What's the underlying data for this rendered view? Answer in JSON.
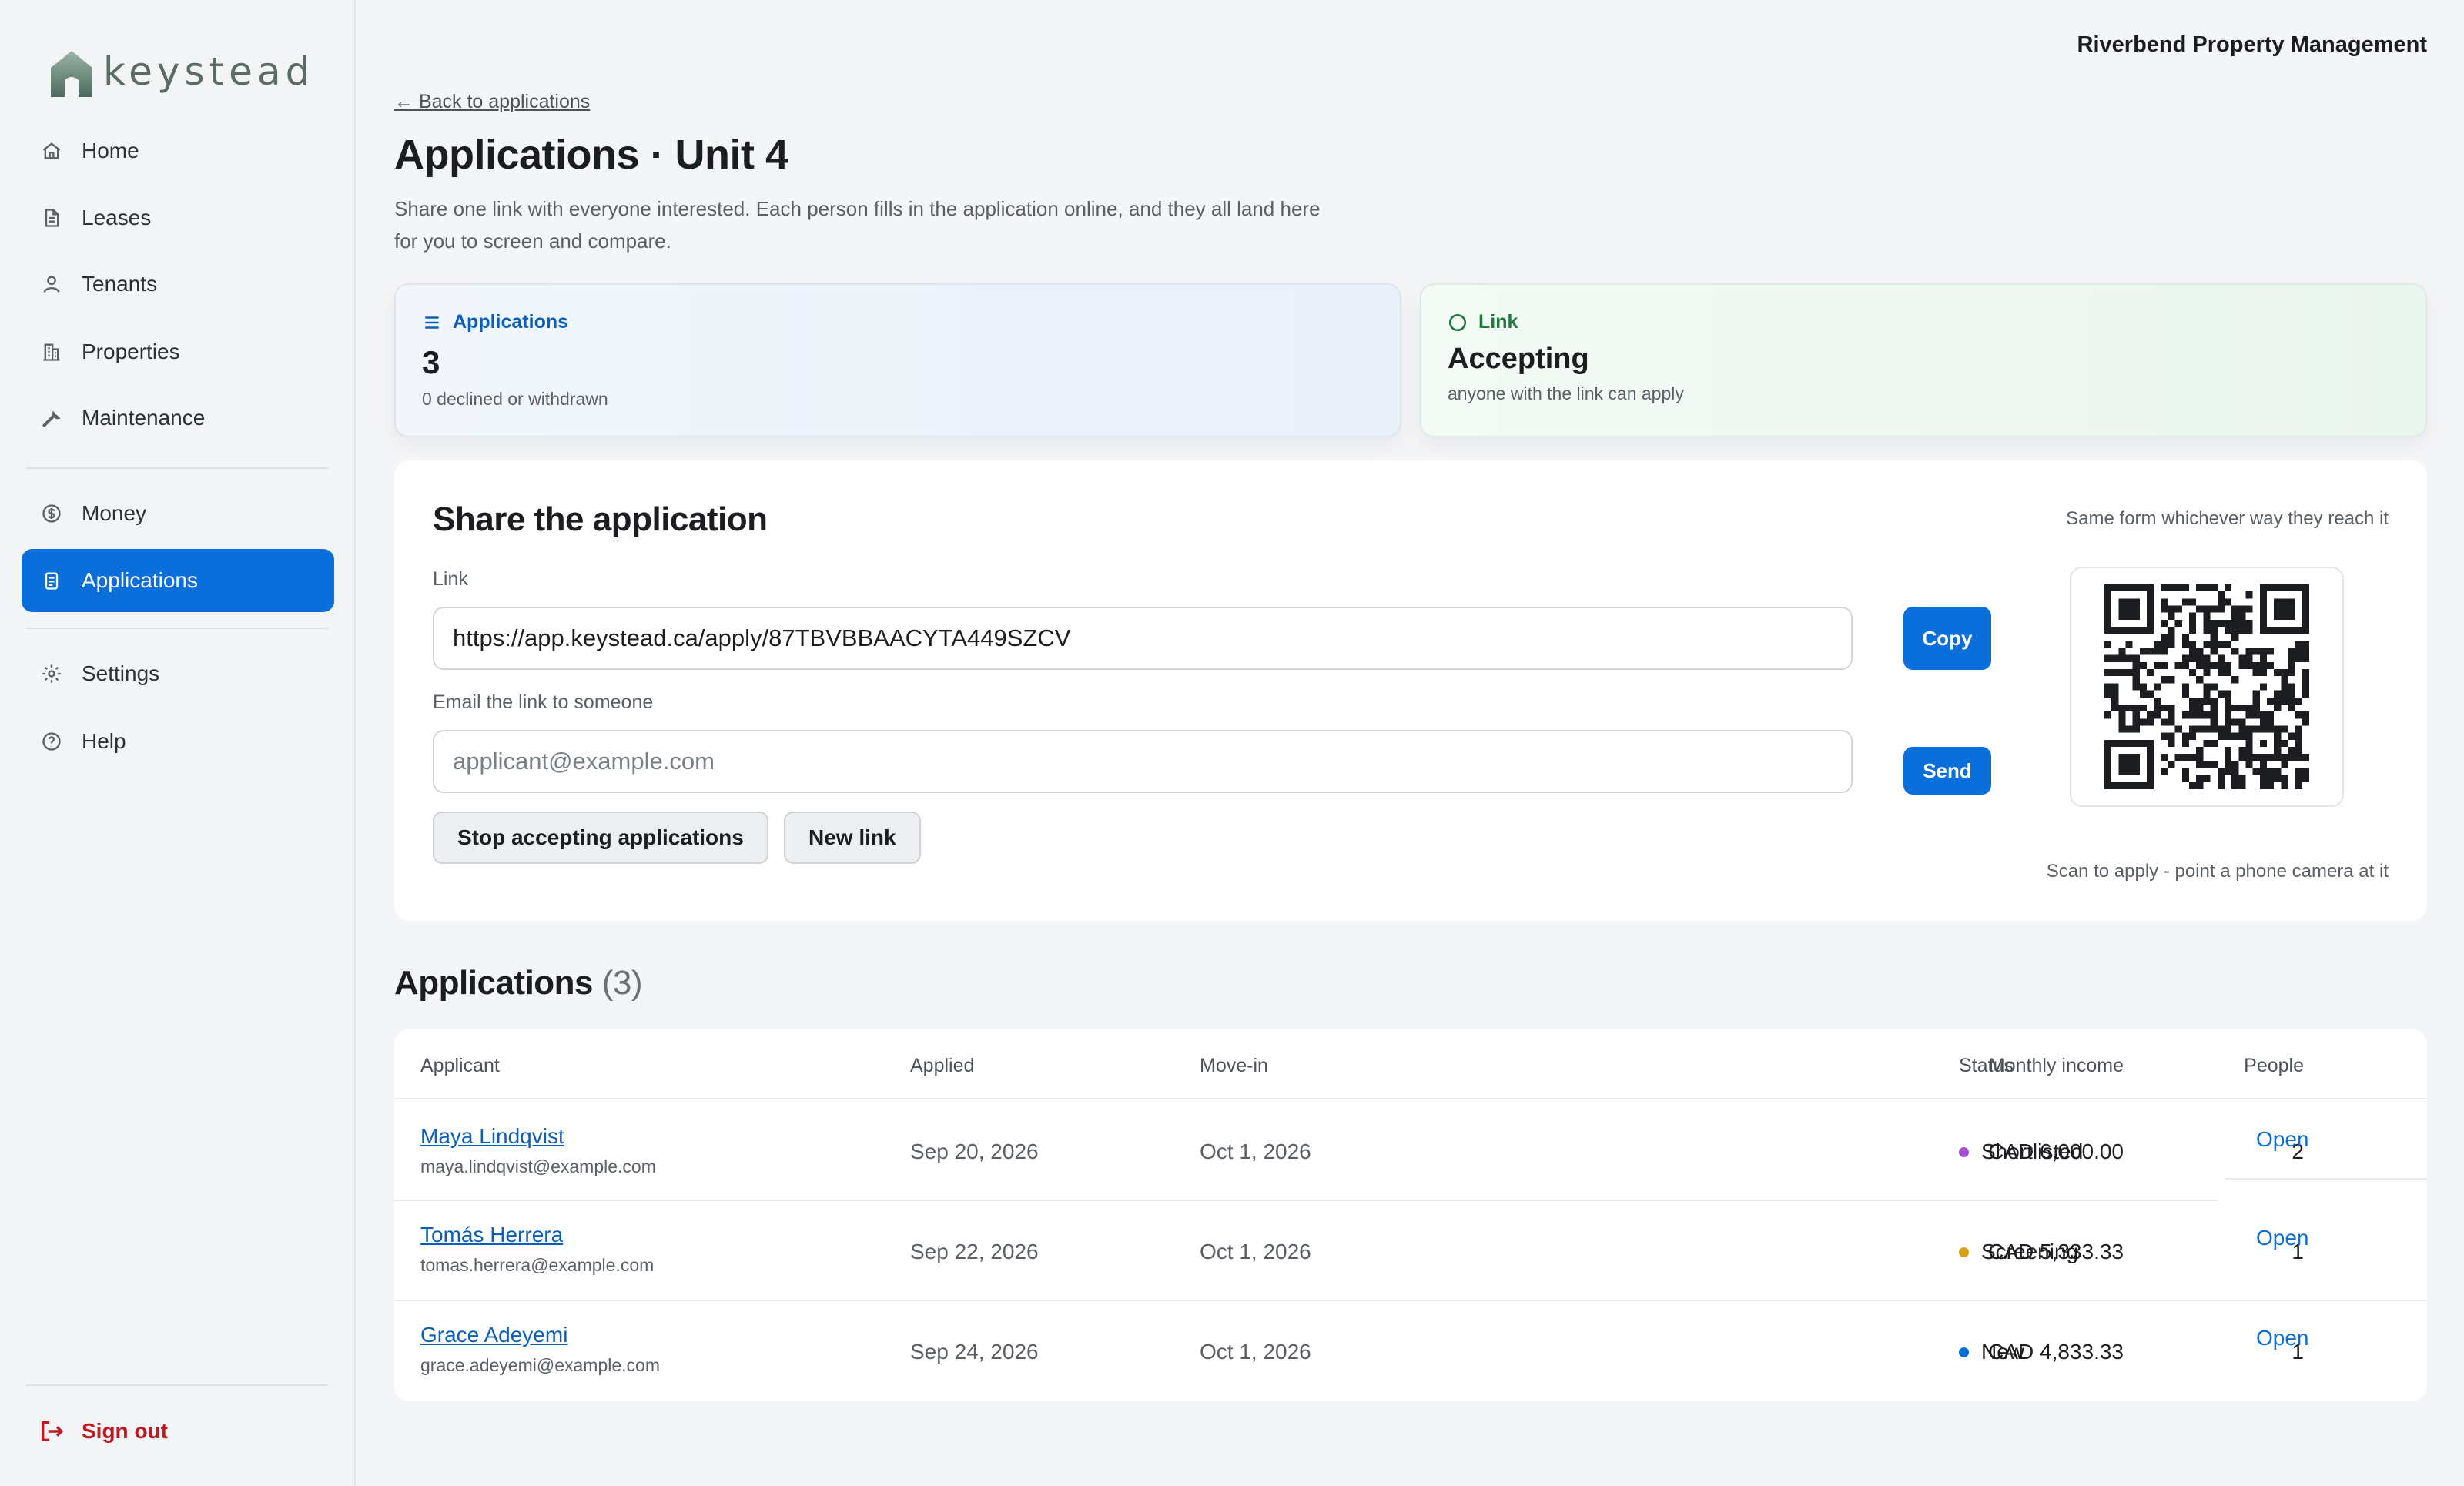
{
  "app": {
    "logo_text": "keystead",
    "org_name": "Riverbend Property Management"
  },
  "nav": {
    "items": [
      {
        "label": "Home",
        "icon": "home-icon"
      },
      {
        "label": "Leases",
        "icon": "document-icon"
      },
      {
        "label": "Tenants",
        "icon": "person-icon"
      },
      {
        "label": "Properties",
        "icon": "building-icon"
      },
      {
        "label": "Maintenance",
        "icon": "wrench-icon"
      },
      {
        "label": "Money",
        "icon": "dollar-circle-icon"
      },
      {
        "label": "Applications",
        "icon": "clipboard-icon",
        "active": true
      },
      {
        "label": "Settings",
        "icon": "gear-icon"
      },
      {
        "label": "Help",
        "icon": "help-circle-icon"
      }
    ],
    "sign_out": "Sign out"
  },
  "page": {
    "back_link": "← Back to applications",
    "title": "Applications · Unit 4",
    "subtitle": "Share one link with everyone interested. Each person fills in the application online, and they all land here for you to screen and compare."
  },
  "stats": {
    "applications": {
      "label": "Applications",
      "value": "3",
      "note": "0 declined or withdrawn"
    },
    "link": {
      "label": "Link",
      "value": "Accepting",
      "note": "anyone with the link can apply"
    }
  },
  "share": {
    "title": "Share the application",
    "right_note": "Same form whichever way they reach it",
    "link_label": "Link",
    "link_value": "https://app.keystead.ca/apply/87TBVBBAACYTA449SZCV",
    "copy_label": "Copy",
    "email_label": "Email the link to someone",
    "email_placeholder": "applicant@example.com",
    "send_label": "Send",
    "stop_label": "Stop accepting applications",
    "new_link_label": "New link",
    "qr_note": "Scan to apply - point a phone camera at it"
  },
  "list": {
    "title": "Applications",
    "count": "(3)",
    "columns": [
      "Applicant",
      "Applied",
      "Move-in",
      "Monthly income",
      "People",
      "Status"
    ],
    "open_label": "Open",
    "rows": [
      {
        "name": "Maya Lindqvist",
        "email": "maya.lindqvist@example.com",
        "applied": "Sep 20, 2026",
        "move_in": "Oct 1, 2026",
        "income": "CAD 6,000.00",
        "people": "2",
        "status": "Shortlisted",
        "status_color": "#a24fd1"
      },
      {
        "name": "Tomás Herrera",
        "email": "tomas.herrera@example.com",
        "applied": "Sep 22, 2026",
        "move_in": "Oct 1, 2026",
        "income": "CAD 5,333.33",
        "people": "1",
        "status": "Screening",
        "status_color": "#d6a21c"
      },
      {
        "name": "Grace Adeyemi",
        "email": "grace.adeyemi@example.com",
        "applied": "Sep 24, 2026",
        "move_in": "Oct 1, 2026",
        "income": "CAD 4,833.33",
        "people": "1",
        "status": "New",
        "status_color": "#0b6fdb"
      }
    ]
  },
  "colors": {
    "accent": "#0b6fdb",
    "danger": "#c0191f",
    "success": "#1f7a3e"
  }
}
